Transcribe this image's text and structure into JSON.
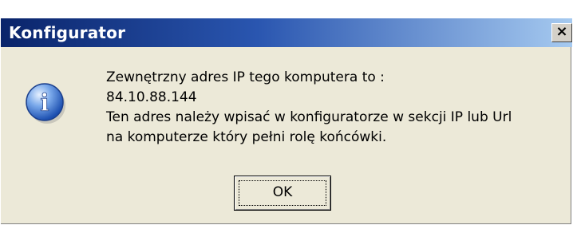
{
  "window": {
    "title": "Konfigurator",
    "close_label": "×"
  },
  "icon": {
    "name": "info-icon",
    "glyph": "i",
    "color": "#2a62c8"
  },
  "message": {
    "line1": "Zewnętrzny adres IP tego komputera to :",
    "line2": "84.10.88.144",
    "line3": "Ten adres należy wpisać w konfiguratorze w sekcji IP lub Url",
    "line4": "na komputerze który pełni rolę końcówki."
  },
  "buttons": {
    "ok_label": "OK"
  }
}
